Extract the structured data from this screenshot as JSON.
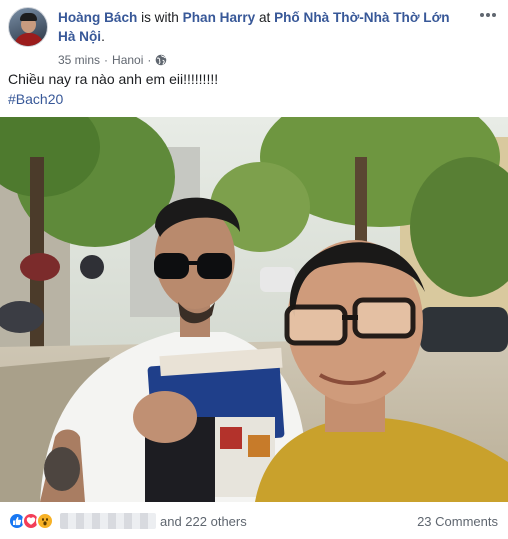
{
  "post": {
    "author": "Hoàng Bách",
    "with_text": " is with ",
    "tagged": "Phan Harry",
    "at_text": " at ",
    "location": "Phố Nhà Thờ-Nhà Thờ Lớn Hà Nội",
    "location_end": ".",
    "time": "35 mins",
    "place": "Hanoi",
    "separator": "·",
    "privacy_icon": "globe-icon",
    "text": "Chiều nay ra nào anh em eii!!!!!!!!!",
    "hashtag": "#Bach20",
    "photo_icon": "photo"
  },
  "footer": {
    "reaction_icons": [
      "like-icon",
      "love-icon",
      "wow-icon"
    ],
    "others": "and 222 others",
    "comments": "23 Comments"
  },
  "colors": {
    "link": "#385898",
    "meta": "#616770",
    "like": "#1877f2",
    "love": "#f33e58",
    "wow": "#f7b125"
  }
}
